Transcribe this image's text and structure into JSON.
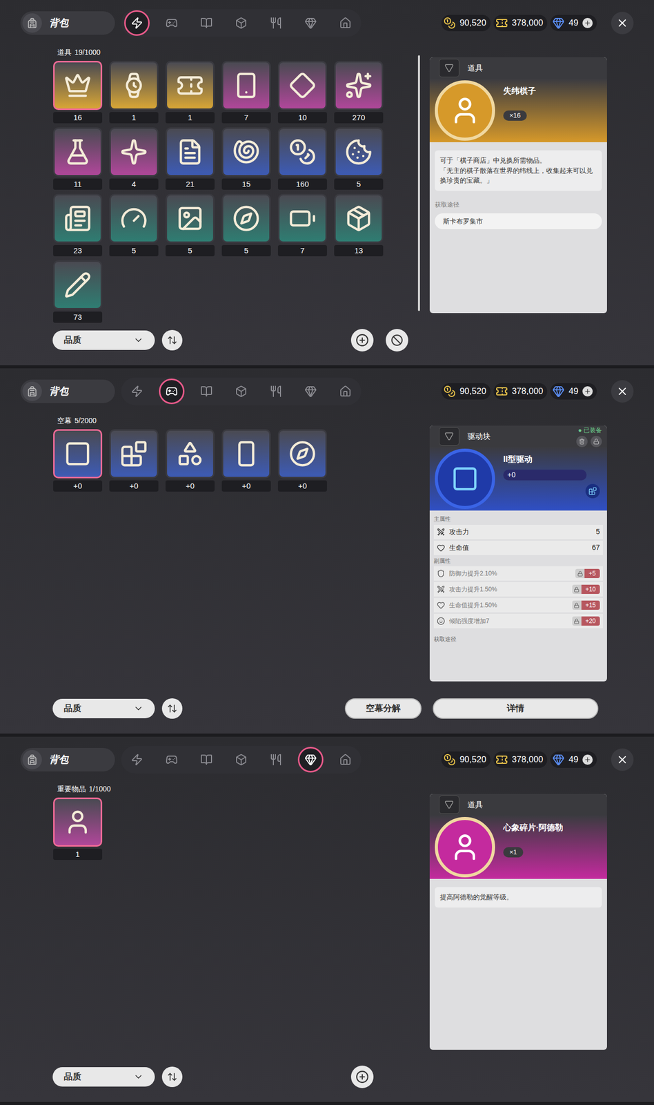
{
  "panels": [
    {
      "title": "背包",
      "tabs": [
        {
          "selected": true
        },
        {
          "selected": false
        },
        {
          "selected": false
        },
        {
          "selected": false
        },
        {
          "selected": false
        },
        {
          "selected": false
        },
        {
          "selected": false
        }
      ],
      "currencies": [
        {
          "value": "90,520",
          "plus": false
        },
        {
          "value": "378,000",
          "plus": false
        },
        {
          "value": "49",
          "plus": true
        }
      ],
      "section": {
        "label": "道具",
        "count": "19/1000"
      },
      "scrollbar": true,
      "items": [
        {
          "count": "16",
          "color": "#d8a636",
          "selected": true
        },
        {
          "count": "1",
          "color": "#d8a636",
          "selected": false
        },
        {
          "count": "1",
          "color": "#d8a636",
          "selected": false
        },
        {
          "count": "7",
          "color": "#b0479a",
          "selected": false
        },
        {
          "count": "10",
          "color": "#b0479a",
          "selected": false
        },
        {
          "count": "270",
          "color": "#b0479a",
          "selected": false
        },
        {
          "count": "11",
          "color": "#b0479a",
          "selected": false
        },
        {
          "count": "4",
          "color": "#b0479a",
          "selected": false
        },
        {
          "count": "21",
          "color": "#3d5bb5",
          "selected": false
        },
        {
          "count": "15",
          "color": "#3d5bb5",
          "selected": false
        },
        {
          "count": "160",
          "color": "#3d5bb5",
          "selected": false
        },
        {
          "count": "5",
          "color": "#3d5bb5",
          "selected": false
        },
        {
          "count": "23",
          "color": "#2f7d72",
          "selected": false
        },
        {
          "count": "5",
          "color": "#2f7d72",
          "selected": false
        },
        {
          "count": "5",
          "color": "#2f7d72",
          "selected": false
        },
        {
          "count": "5",
          "color": "#2f7d72",
          "selected": false
        },
        {
          "count": "7",
          "color": "#2f7d72",
          "selected": false
        },
        {
          "count": "13",
          "color": "#2f7d72",
          "selected": false
        },
        {
          "count": "73",
          "color": "#2f7d72",
          "selected": false
        }
      ],
      "detail": {
        "kind": "item",
        "category": "道具",
        "name": "失纬棋子",
        "quantity": "×16",
        "color": "#d6992a",
        "description": [
          "可于「棋子商店」中兑换所需物品。",
          "「无主的棋子散落在世界的纬线上，收集起来可以兑换珍贵的宝藏。」"
        ],
        "source_label": "获取途径",
        "sources": [
          "斯卡布罗集市"
        ]
      },
      "sort_label": "品质",
      "actions": [
        {
          "kind": "add"
        },
        {
          "kind": "filter"
        }
      ]
    },
    {
      "title": "背包",
      "tabs": [
        {
          "selected": false
        },
        {
          "selected": true
        },
        {
          "selected": false
        },
        {
          "selected": false
        },
        {
          "selected": false
        },
        {
          "selected": false
        },
        {
          "selected": false
        }
      ],
      "currencies": [
        {
          "value": "90,520",
          "plus": false
        },
        {
          "value": "378,000",
          "plus": false
        },
        {
          "value": "49",
          "plus": true
        }
      ],
      "section": {
        "label": "空幕",
        "count": "5/2000"
      },
      "scrollbar": false,
      "items": [
        {
          "count": "+0",
          "color": "#3d5bb5",
          "selected": true
        },
        {
          "count": "+0",
          "color": "#3d5bb5",
          "selected": false
        },
        {
          "count": "+0",
          "color": "#3d5bb5",
          "selected": false
        },
        {
          "count": "+0",
          "color": "#3d5bb5",
          "selected": false
        },
        {
          "count": "+0",
          "color": "#3d5bb5",
          "selected": false
        }
      ],
      "detail": {
        "kind": "drive",
        "category": "驱动块",
        "equipped_label": "已装备",
        "name": "II型驱动",
        "level": "+0",
        "color": "#2f4fc4",
        "main_label": "主属性",
        "main_stats": [
          {
            "name": "攻击力",
            "value": "5"
          },
          {
            "name": "生命值",
            "value": "67"
          }
        ],
        "sub_label": "副属性",
        "sub_stats": [
          {
            "name": "防御力提升2.10%",
            "bonus": "+5",
            "locked": true
          },
          {
            "name": "攻击力提升1.50%",
            "bonus": "+10",
            "locked": true
          },
          {
            "name": "生命值提升1.50%",
            "bonus": "+15",
            "locked": true
          },
          {
            "name": "倾陷强度增加7",
            "bonus": "+20",
            "locked": true
          }
        ],
        "source_label": "获取途径"
      },
      "sort_label": "品质",
      "actions": [
        {
          "kind": "text",
          "label": "空幕分解"
        },
        {
          "kind": "wide",
          "label": "详情"
        }
      ]
    },
    {
      "title": "背包",
      "tabs": [
        {
          "selected": false
        },
        {
          "selected": false
        },
        {
          "selected": false
        },
        {
          "selected": false
        },
        {
          "selected": false
        },
        {
          "selected": true
        },
        {
          "selected": false
        }
      ],
      "currencies": [
        {
          "value": "90,520",
          "plus": false
        },
        {
          "value": "378,000",
          "plus": false
        },
        {
          "value": "49",
          "plus": true
        }
      ],
      "section": {
        "label": "重要物品",
        "count": "1/1000"
      },
      "scrollbar": false,
      "items": [
        {
          "count": "1",
          "color": "#b0479a",
          "selected": true
        }
      ],
      "detail": {
        "kind": "item",
        "category": "道具",
        "name": "心象碎片·阿德勒",
        "quantity": "×1",
        "color": "#c42a9e",
        "description": [
          "提高阿德勒的觉醒等级。"
        ],
        "source_label": "",
        "sources": []
      },
      "sort_label": "品质",
      "actions": [
        {
          "kind": "add"
        }
      ]
    }
  ]
}
